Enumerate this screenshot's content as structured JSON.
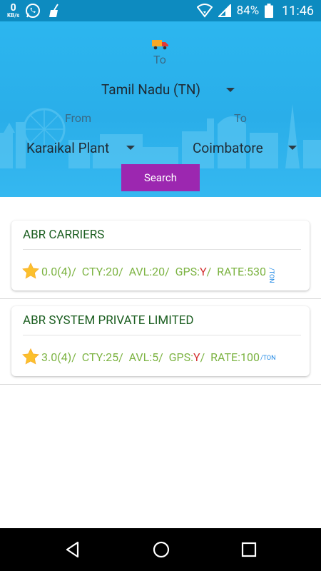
{
  "status_bar": {
    "speed_value": "0",
    "speed_unit": "KB/s",
    "battery": "84%",
    "time": "11:46"
  },
  "search": {
    "to_label": "To",
    "state_value": "Tamil Nadu (TN)",
    "from_label": "From",
    "to_city_label": "To",
    "from_value": "Karaikal Plant",
    "to_value": "Coimbatore",
    "search_button": "Search"
  },
  "results": [
    {
      "name": "ABR CARRIERS",
      "rating": "0.0(4)/",
      "capacity": "CTY:20/",
      "available": "AVL:20/",
      "gps_label": "GPS:",
      "gps_value": "Y",
      "gps_sep": "/",
      "rate": "RATE:530",
      "unit": "/TON"
    },
    {
      "name": "ABR SYSTEM PRIVATE LIMITED",
      "rating": "3.0(4)/",
      "capacity": "CTY:25/",
      "available": "AVL:5/",
      "gps_label": "GPS:",
      "gps_value": "Y",
      "gps_sep": "/",
      "rate": "RATE:100",
      "unit": "/TON"
    }
  ],
  "colors": {
    "header_bg": "#2cb6ef",
    "search_button": "#9c27b0",
    "title_green": "#1b5e20",
    "info_green": "#7cb342",
    "gps_red": "#d32f2f",
    "unit_blue": "#1e88e5",
    "star": "#fbc02d"
  },
  "icons": {
    "status_left": [
      "whatsapp-icon",
      "broom-icon"
    ],
    "status_right": [
      "signal-icon",
      "cell-signal-icon",
      "battery-icon"
    ],
    "header": "truck-icon",
    "rating": "star-icon",
    "nav": [
      "back-icon",
      "home-icon",
      "recents-icon"
    ]
  }
}
